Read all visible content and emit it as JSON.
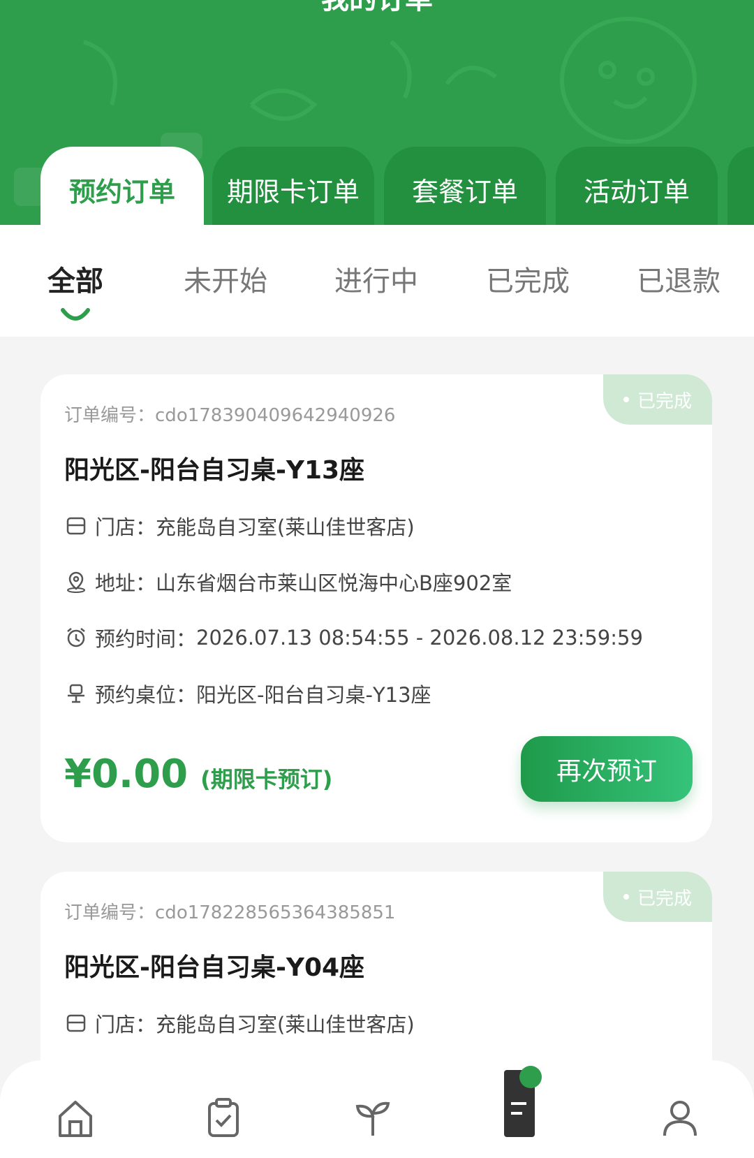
{
  "header": {
    "title": "我的订单"
  },
  "category_tabs": [
    "预约订单",
    "期限卡订单",
    "套餐订单",
    "活动订单"
  ],
  "status_tabs": [
    "全部",
    "未开始",
    "进行中",
    "已完成",
    "已退款"
  ],
  "orders": [
    {
      "status": "已完成",
      "order_no_label": "订单编号：",
      "order_no": "cdo1783904096429409​26",
      "title": "阳光区-阳台自习桌-Y13座",
      "store_label": "门店：",
      "store": "充能岛自习室(莱山佳世客店)",
      "address_label": "地址：",
      "address": "山东省烟台市莱山区悦海中心B座902室",
      "time_label": "预约时间：",
      "time": "2026.07.13 08:54:55 - 2026.08.12 23:59:59",
      "seat_label": "预约桌位：",
      "seat": "阳光区-阳台自习桌-Y13座",
      "price": "¥0.00",
      "price_note": "(期限卡预订)",
      "rebook": "再次预订"
    },
    {
      "status": "已完成",
      "order_no_label": "订单编号：",
      "order_no": "cdo1782285653643858​51",
      "title": "阳光区-阳台自习桌-Y04座",
      "store_label": "门店：",
      "store": "充能岛自习室(莱山佳世客店)"
    }
  ],
  "bottom_nav": [
    "home-icon",
    "clipboard-check-icon",
    "sprout-icon",
    "orders-icon",
    "profile-icon"
  ],
  "colors": {
    "brand_green": "#2e9e4c",
    "badge_bg": "#cfe9d4"
  }
}
